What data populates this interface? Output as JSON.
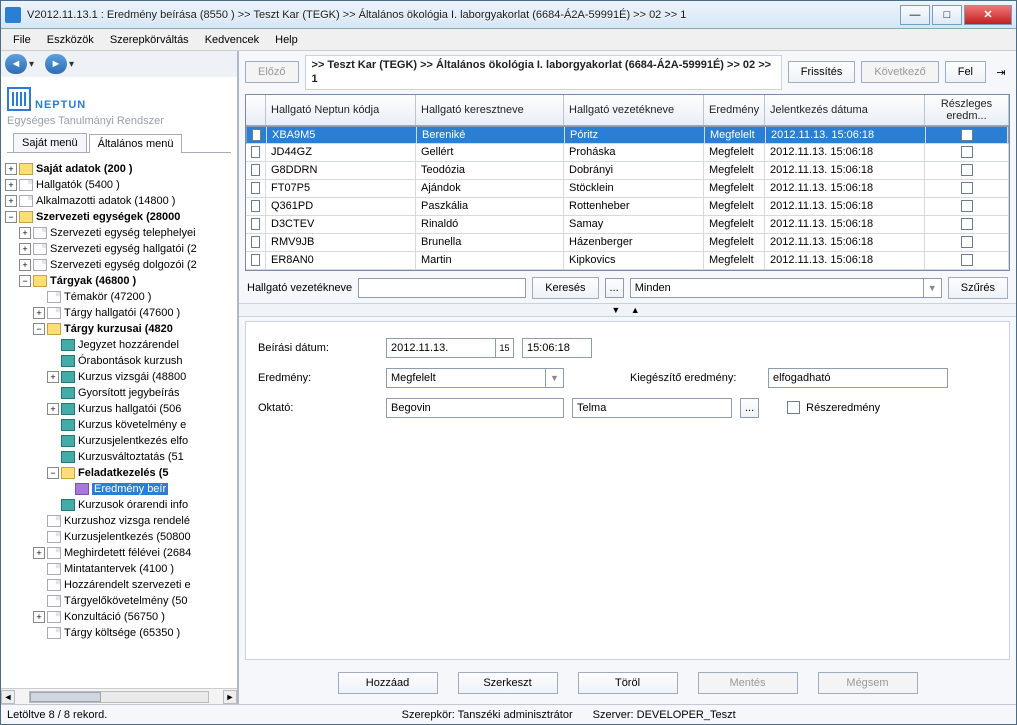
{
  "title": "V2012.11.13.1 : Eredmény beírása (8550  )  >> Teszt Kar (TEGK) >> Általános ökológia  I. laborgyakorlat (6684-Á2A-59991É) >> 02 >> 1",
  "menu": [
    "File",
    "Eszközök",
    "Szerepkörváltás",
    "Kedvencek",
    "Help"
  ],
  "logo": {
    "brand": "NEPTUN",
    "tagline": "Egységes Tanulmányi Rendszer"
  },
  "tabs": {
    "own": "Saját menü",
    "general": "Általános menü"
  },
  "tree": {
    "sajat_adatok": "Saját adatok (200  )",
    "hallgatok": "Hallgatók (5400  )",
    "alkalmazotti": "Alkalmazotti adatok (14800  )",
    "szervezeti": "Szervezeti egységek (28000",
    "sze_telep": "Szervezeti egység telephelyei",
    "sze_hall": "Szervezeti egység hallgatói (2",
    "sze_dolg": "Szervezeti egység dolgozói (2",
    "targyak": "Tárgyak (46800  )",
    "temakor": "Témakör (47200  )",
    "targy_hall": "Tárgy hallgatói (47600  )",
    "targy_kurz": "Tárgy kurzusai (4820",
    "jegyzet": "Jegyzet hozzárendel",
    "orabont": "Órabontások kurzush",
    "kurzus_vizsg": "Kurzus vizsgái (48800",
    "gyors": "Gyorsított jegybeírás",
    "kurzus_hall": "Kurzus hallgatói (506",
    "kurzus_kov": "Kurzus követelmény e",
    "kurzusjel_elf": "Kurzusjelentkezés elfo",
    "kurzusvalt": "Kurzusváltoztatás (51",
    "feladatkez": "Feladatkezelés (5",
    "eredmeny_beir": "Eredmény beír",
    "kurzus_orarendi": "Kurzusok órarendi info",
    "kurzushoz_vizsga": "Kurzushoz vizsga rendelé",
    "kurzusjel": "Kurzusjelentkezés (50800",
    "meghird": "Meghirdetett félévei (2684",
    "mintatant": "Mintatantervek (4100  )",
    "hozzarendelt": "Hozzárendelt szervezeti e",
    "targyelok": "Tárgyelőkövetelmény (50",
    "konzult": "Konzultáció (56750  )",
    "targy_kolt": "Tárgy költsége (65350  )"
  },
  "breadcrumb": ">> Teszt Kar (TEGK) >> Általános ökológia  I. laborgyakorlat (6684-Á2A-59991É) >> 02 >> 1",
  "topButtons": {
    "prev": "Előző",
    "refresh": "Frissítés",
    "next": "Következő",
    "up": "Fel"
  },
  "grid": {
    "columns": {
      "code": "Hallgató Neptun kódja",
      "first": "Hallgató keresztneve",
      "last": "Hallgató vezetékneve",
      "result": "Eredmény",
      "date": "Jelentkezés dátuma",
      "partial": "Részleges eredm..."
    },
    "rows": [
      {
        "code": "XBA9M5",
        "first": "Bereniké",
        "last": "Póritz",
        "result": "Megfelelt",
        "date": "2012.11.13. 15:06:18"
      },
      {
        "code": "JD44GZ",
        "first": "Gellért",
        "last": "Proháska",
        "result": "Megfelelt",
        "date": "2012.11.13. 15:06:18"
      },
      {
        "code": "G8DDRN",
        "first": "Teodózia",
        "last": "Dobrányi",
        "result": "Megfelelt",
        "date": "2012.11.13. 15:06:18"
      },
      {
        "code": "FT07P5",
        "first": "Ajándok",
        "last": "Stöcklein",
        "result": "Megfelelt",
        "date": "2012.11.13. 15:06:18"
      },
      {
        "code": "Q361PD",
        "first": "Paszkália",
        "last": "Rottenheber",
        "result": "Megfelelt",
        "date": "2012.11.13. 15:06:18"
      },
      {
        "code": "D3CTEV",
        "first": "Rinaldó",
        "last": "Samay",
        "result": "Megfelelt",
        "date": "2012.11.13. 15:06:18"
      },
      {
        "code": "RMV9JB",
        "first": "Brunella",
        "last": "Házenberger",
        "result": "Megfelelt",
        "date": "2012.11.13. 15:06:18"
      },
      {
        "code": "ER8AN0",
        "first": "Martin",
        "last": "Kipkovics",
        "result": "Megfelelt",
        "date": "2012.11.13. 15:06:18"
      }
    ]
  },
  "search": {
    "label": "Hallgató vezetékneve",
    "button": "Keresés",
    "more": "...",
    "filter": "Minden",
    "filterBtn": "Szűrés"
  },
  "form": {
    "date_label": "Beírási dátum:",
    "date": "2012.11.13.",
    "time": "15:06:18",
    "result_label": "Eredmény:",
    "result": "Megfelelt",
    "kieg_label": "Kiegészítő eredmény:",
    "kieg": "elfogadható",
    "oktato_label": "Oktató:",
    "oktato_last": "Begovin",
    "oktato_first": "Telma",
    "oktato_more": "...",
    "partial_label": "Részeredmény"
  },
  "bottom": {
    "add": "Hozzáad",
    "edit": "Szerkeszt",
    "delete": "Töröl",
    "save": "Mentés",
    "cancel": "Mégsem"
  },
  "status": {
    "left": "Letöltve 8 / 8 rekord.",
    "role": "Szerepkör: Tanszéki adminisztrátor",
    "server": "Szerver: DEVELOPER_Teszt"
  }
}
